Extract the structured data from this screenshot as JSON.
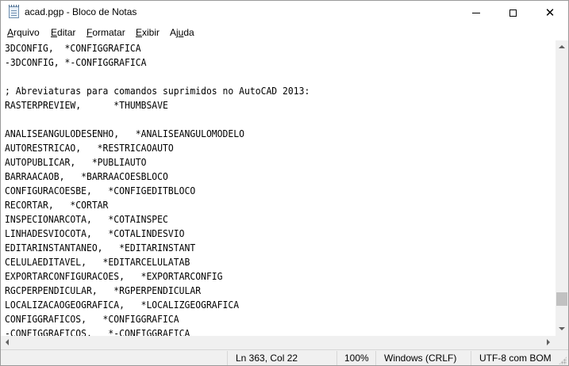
{
  "window": {
    "title": "acad.pgp - Bloco de Notas",
    "close_symbol": "✕"
  },
  "menu": {
    "items": [
      {
        "first": "A",
        "rest": "rquivo"
      },
      {
        "first": "E",
        "rest": "ditar"
      },
      {
        "first": "F",
        "rest": "ormatar"
      },
      {
        "first": "E",
        "rest": "xibir"
      },
      {
        "first": "",
        "pre": "Aj",
        "mid": "u",
        "post": "da"
      }
    ]
  },
  "editor": {
    "lines": [
      "3DCONFIG,  *CONFIGGRAFICA",
      "-3DCONFIG, *-CONFIGGRAFICA",
      "",
      "; Abreviaturas para comandos suprimidos no AutoCAD 2013:",
      "RASTERPREVIEW,      *THUMBSAVE",
      "",
      "ANALISEANGULODESENHO,   *ANALISEANGULOMODELO",
      "AUTORESTRICAO,   *RESTRICAOAUTO",
      "AUTOPUBLICAR,   *PUBLIAUTO",
      "BARRAACAOB,   *BARRAACOESBLOCO",
      "CONFIGURACOESBE,   *CONFIGEDITBLOCO",
      "RECORTAR,   *CORTAR",
      "INSPECIONARCOTA,   *COTAINSPEC",
      "LINHADESVIOCOTA,   *COTALINDESVIO",
      "EDITARINSTANTANEO,   *EDITARINSTANT",
      "CELULAEDITAVEL,   *EDITARCELULATAB",
      "EXPORTARCONFIGURACOES,   *EXPORTARCONFIG",
      "RGCPERPENDICULAR,   *RGPERPENDICULAR",
      "LOCALIZACAOGEOGRAFICA,   *LOCALIZGEOGRAFICA",
      "CONFIGGRAFICOS,   *CONFIGGRAFICA",
      "-CONFIGGRAFICOS,   *-CONFIGGRAFICA"
    ]
  },
  "status": {
    "position": "Ln 363, Col 22",
    "zoom": "100%",
    "line_ending": "Windows (CRLF)",
    "encoding": "UTF-8 com BOM"
  },
  "icons": [
    "notepad-app-icon",
    "minimize-icon",
    "maximize-icon",
    "close-icon",
    "scroll-up-arrow-icon",
    "scroll-down-arrow-icon",
    "scroll-left-arrow-icon",
    "scroll-right-arrow-icon",
    "resize-grip-icon"
  ],
  "colors": {
    "background": "#ffffff",
    "chrome": "#f0f0f0",
    "scroll_thumb": "#c1c1c1",
    "text": "#000000"
  }
}
